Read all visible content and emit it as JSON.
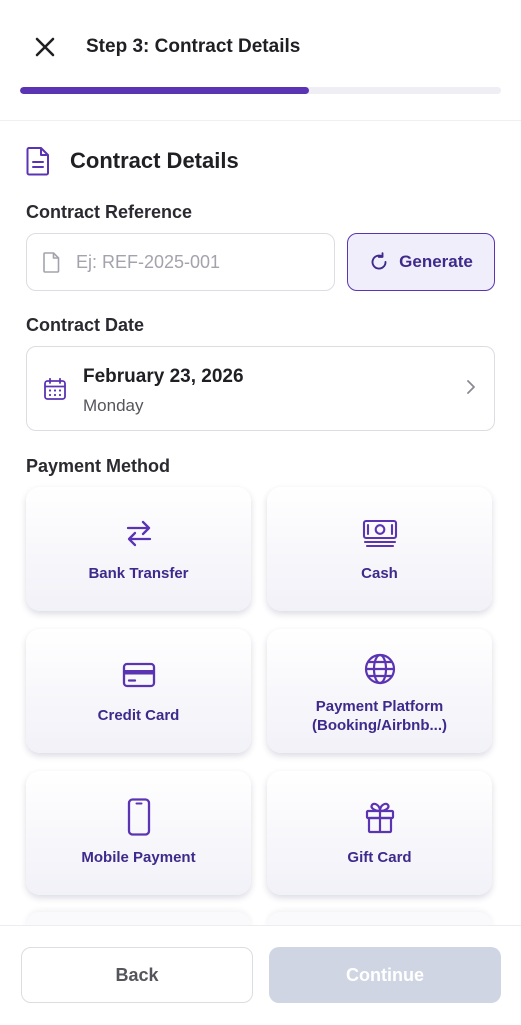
{
  "header": {
    "title": "Step 3: Contract Details",
    "progress_fraction": 0.6,
    "close_icon": "close-icon"
  },
  "section": {
    "title": "Contract Details",
    "icon": "document-icon"
  },
  "contract_reference": {
    "label": "Contract Reference",
    "value": "",
    "placeholder": "Ej: REF-2025-001",
    "generate_label": "Generate"
  },
  "contract_date": {
    "label": "Contract Date",
    "date": "February 23, 2026",
    "weekday": "Monday"
  },
  "payment_method": {
    "label": "Payment Method",
    "options": [
      {
        "label": "Bank Transfer",
        "icon": "transfer-arrows-icon"
      },
      {
        "label": "Cash",
        "icon": "banknote-icon"
      },
      {
        "label": "Credit Card",
        "icon": "credit-card-icon"
      },
      {
        "label": "Payment Platform\n(Booking/Airbnb...)",
        "icon": "globe-icon"
      },
      {
        "label": "Mobile Payment",
        "icon": "smartphone-icon"
      },
      {
        "label": "Gift Card",
        "icon": "gift-icon"
      }
    ]
  },
  "footer": {
    "back_label": "Back",
    "continue_label": "Continue"
  },
  "colors": {
    "accent": "#5b34b3",
    "accent_dark": "#3f2a8c",
    "accent_light": "#f1eefb",
    "disabled": "#cfd5e3"
  }
}
